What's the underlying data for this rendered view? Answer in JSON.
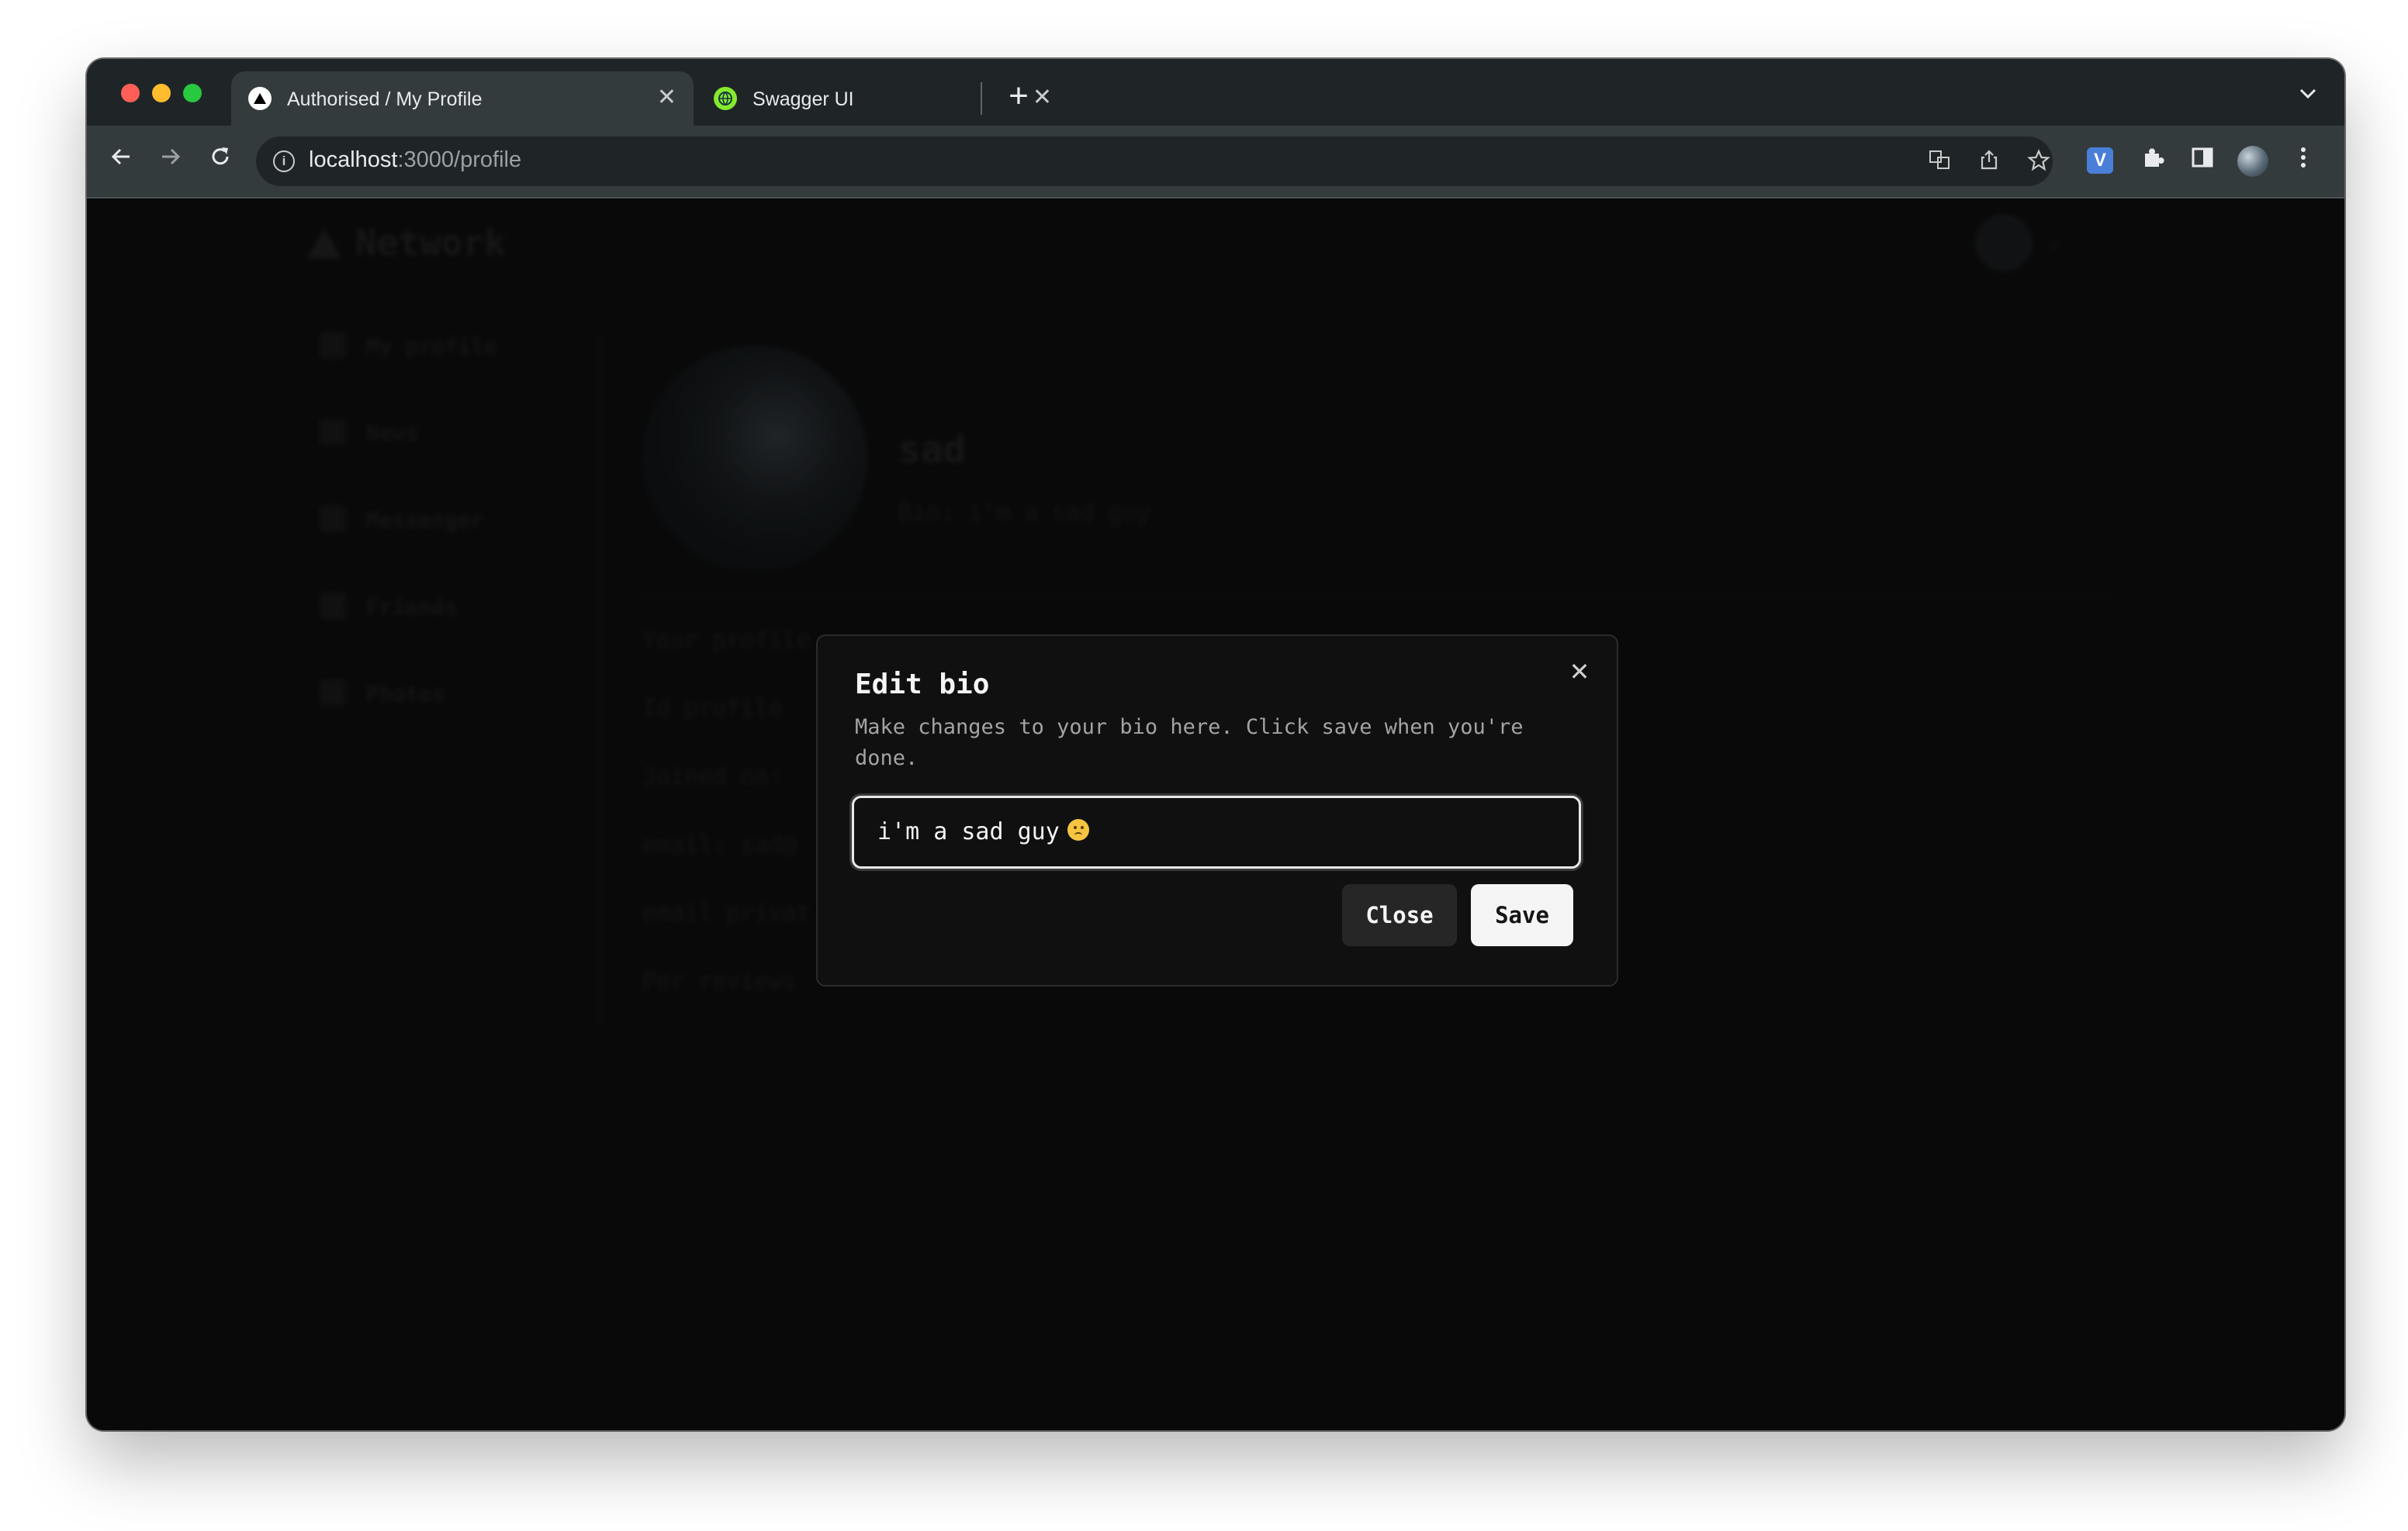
{
  "browser": {
    "tabs": [
      {
        "title": "Authorised / My Profile",
        "active": true,
        "favicon": "triangle-logo-icon"
      },
      {
        "title": "Swagger UI",
        "active": false,
        "favicon": "swagger-globe-icon"
      }
    ],
    "new_tab_symbol": "+",
    "tab_close_symbol": "✕",
    "url_host": "localhost",
    "url_rest": ":3000/profile",
    "extension_v_label": "V"
  },
  "background_page": {
    "logo_text": "Network",
    "sidebar": [
      "My profile",
      "News",
      "Messenger",
      "Friends",
      "Photos"
    ],
    "profile_name": "sad",
    "profile_bio": "Bio: i'm a sad guy",
    "info_lines": [
      "Your profile",
      "Id profile",
      "Joined on:",
      "email: sad@",
      "email privat",
      "Per reviews"
    ]
  },
  "dialog": {
    "title": "Edit bio",
    "description": "Make changes to your bio here. Click save when you're done.",
    "bio_value": "i'm a sad guy",
    "close_label": "Close",
    "save_label": "Save",
    "x_symbol": "✕"
  },
  "colors": {
    "page_bg": "#121212",
    "chrome_dark": "#1f2526",
    "chrome_toolbar": "#343b3c",
    "dialog_bg": "#101010",
    "save_button_bg": "#f5f5f5"
  }
}
